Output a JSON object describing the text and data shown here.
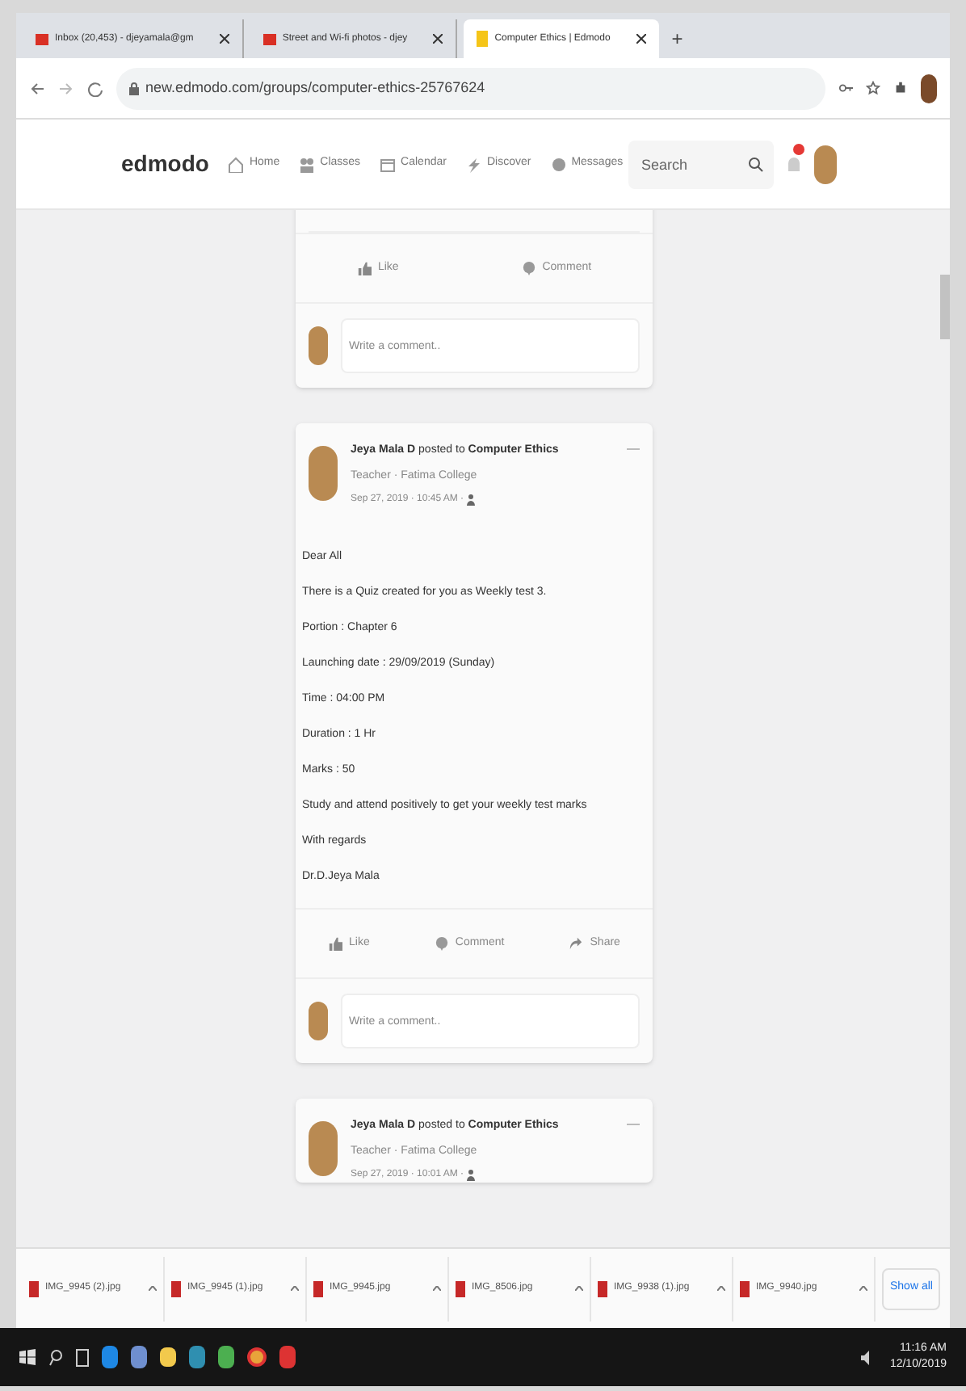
{
  "browser": {
    "tabs": [
      {
        "title": "Inbox (20,453) - djeyamala@gm",
        "selected": false,
        "kind": "mail"
      },
      {
        "title": "Street and Wi-fi photos - djey",
        "selected": false,
        "kind": "mail"
      },
      {
        "title": "Computer Ethics | Edmodo",
        "selected": true,
        "kind": "edmodo"
      }
    ],
    "new_tab": "+",
    "url": "new.edmodo.com/groups/computer-ethics-25767624"
  },
  "header": {
    "logo": "edmodo",
    "nav": [
      {
        "label": "Home",
        "kind": "home"
      },
      {
        "label": "Classes",
        "kind": "classes"
      },
      {
        "label": "Calendar",
        "kind": "calendar"
      },
      {
        "label": "Discover",
        "kind": "discover"
      },
      {
        "label": "Messages",
        "kind": "messages"
      }
    ],
    "search": {
      "placeholder": "Search"
    }
  },
  "posts": [
    {
      "partial": true,
      "actions": [
        {
          "label": "Like",
          "kind": "like"
        },
        {
          "label": "Comment",
          "kind": "comment"
        }
      ],
      "comment_placeholder": "Write a comment.."
    },
    {
      "partial": false,
      "author": "Jeya Mala D",
      "posted_to": "posted to",
      "group": "Computer Ethics",
      "role": "Teacher · Fatima College",
      "time": "Sep 27, 2019 · 10:45 AM ·",
      "body": [
        "Dear All",
        "There is a Quiz created for you as Weekly test 3.",
        "Portion : Chapter 6",
        "Launching date : 29/09/2019 (Sunday)",
        "Time : 04:00 PM",
        "Duration : 1 Hr",
        "Marks : 50",
        "Study and attend positively to get your weekly test marks",
        "With regards",
        "Dr.D.Jeya Mala"
      ],
      "actions": [
        {
          "label": "Like",
          "kind": "like"
        },
        {
          "label": "Comment",
          "kind": "comment"
        },
        {
          "label": "Share",
          "kind": "share"
        }
      ],
      "comment_placeholder": "Write a comment.."
    },
    {
      "partial": false,
      "author": "Jeya Mala D",
      "posted_to": "posted to",
      "group": "Computer Ethics",
      "role": "Teacher · Fatima College",
      "time": "Sep 27, 2019 · 10:01 AM ·"
    }
  ],
  "downloads": {
    "files": [
      "IMG_9945 (2).jpg",
      "IMG_9945 (1).jpg",
      "IMG_9945.jpg",
      "IMG_8506.jpg",
      "IMG_9938 (1).jpg",
      "IMG_9940.jpg"
    ],
    "show_all": "Show all"
  },
  "taskbar": {
    "time": "11:16 AM",
    "date": "12/10/2019"
  }
}
